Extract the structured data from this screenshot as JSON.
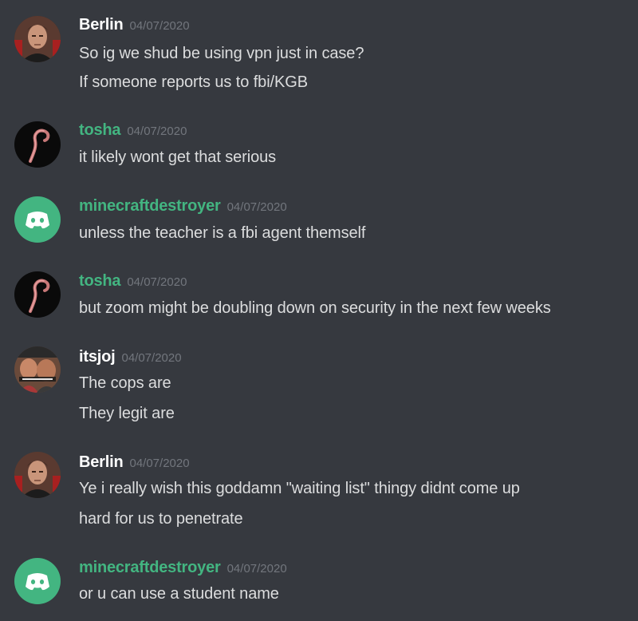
{
  "colors": {
    "background": "#36393f",
    "username_default": "#ffffff",
    "username_green": "#43b581",
    "timestamp": "#72767d",
    "message_text": "#dcddde",
    "discord_avatar_bg": "#43b581"
  },
  "messages": [
    {
      "author": "Berlin",
      "author_color": "white",
      "avatar": "man-portrait-avatar",
      "timestamp": "04/07/2020",
      "lines": [
        "So ig we shud be using vpn just in case?",
        "If someone reports us to fbi/KGB"
      ]
    },
    {
      "author": "tosha",
      "author_color": "green",
      "avatar": "worm-avatar",
      "timestamp": "04/07/2020",
      "lines": [
        "it likely wont get that serious"
      ]
    },
    {
      "author": "minecraftdestroyer",
      "author_color": "green",
      "avatar": "discord-default-avatar",
      "timestamp": "04/07/2020",
      "lines": [
        "unless the teacher is a fbi agent themself"
      ]
    },
    {
      "author": "tosha",
      "author_color": "green",
      "avatar": "worm-avatar",
      "timestamp": "04/07/2020",
      "lines": [
        "but zoom might be doubling down on security in the next few weeks"
      ]
    },
    {
      "author": "itsjoj",
      "author_color": "white",
      "avatar": "meme-photo-avatar",
      "timestamp": "04/07/2020",
      "lines": [
        "The cops are",
        "They legit are"
      ]
    },
    {
      "author": "Berlin",
      "author_color": "white",
      "avatar": "man-portrait-avatar",
      "timestamp": "04/07/2020",
      "lines": [
        "Ye i really wish this goddamn \"waiting list\" thingy didnt come up",
        "hard for us to penetrate"
      ]
    },
    {
      "author": "minecraftdestroyer",
      "author_color": "green",
      "avatar": "discord-default-avatar",
      "timestamp": "04/07/2020",
      "lines": [
        "or u can use a student name"
      ]
    }
  ]
}
